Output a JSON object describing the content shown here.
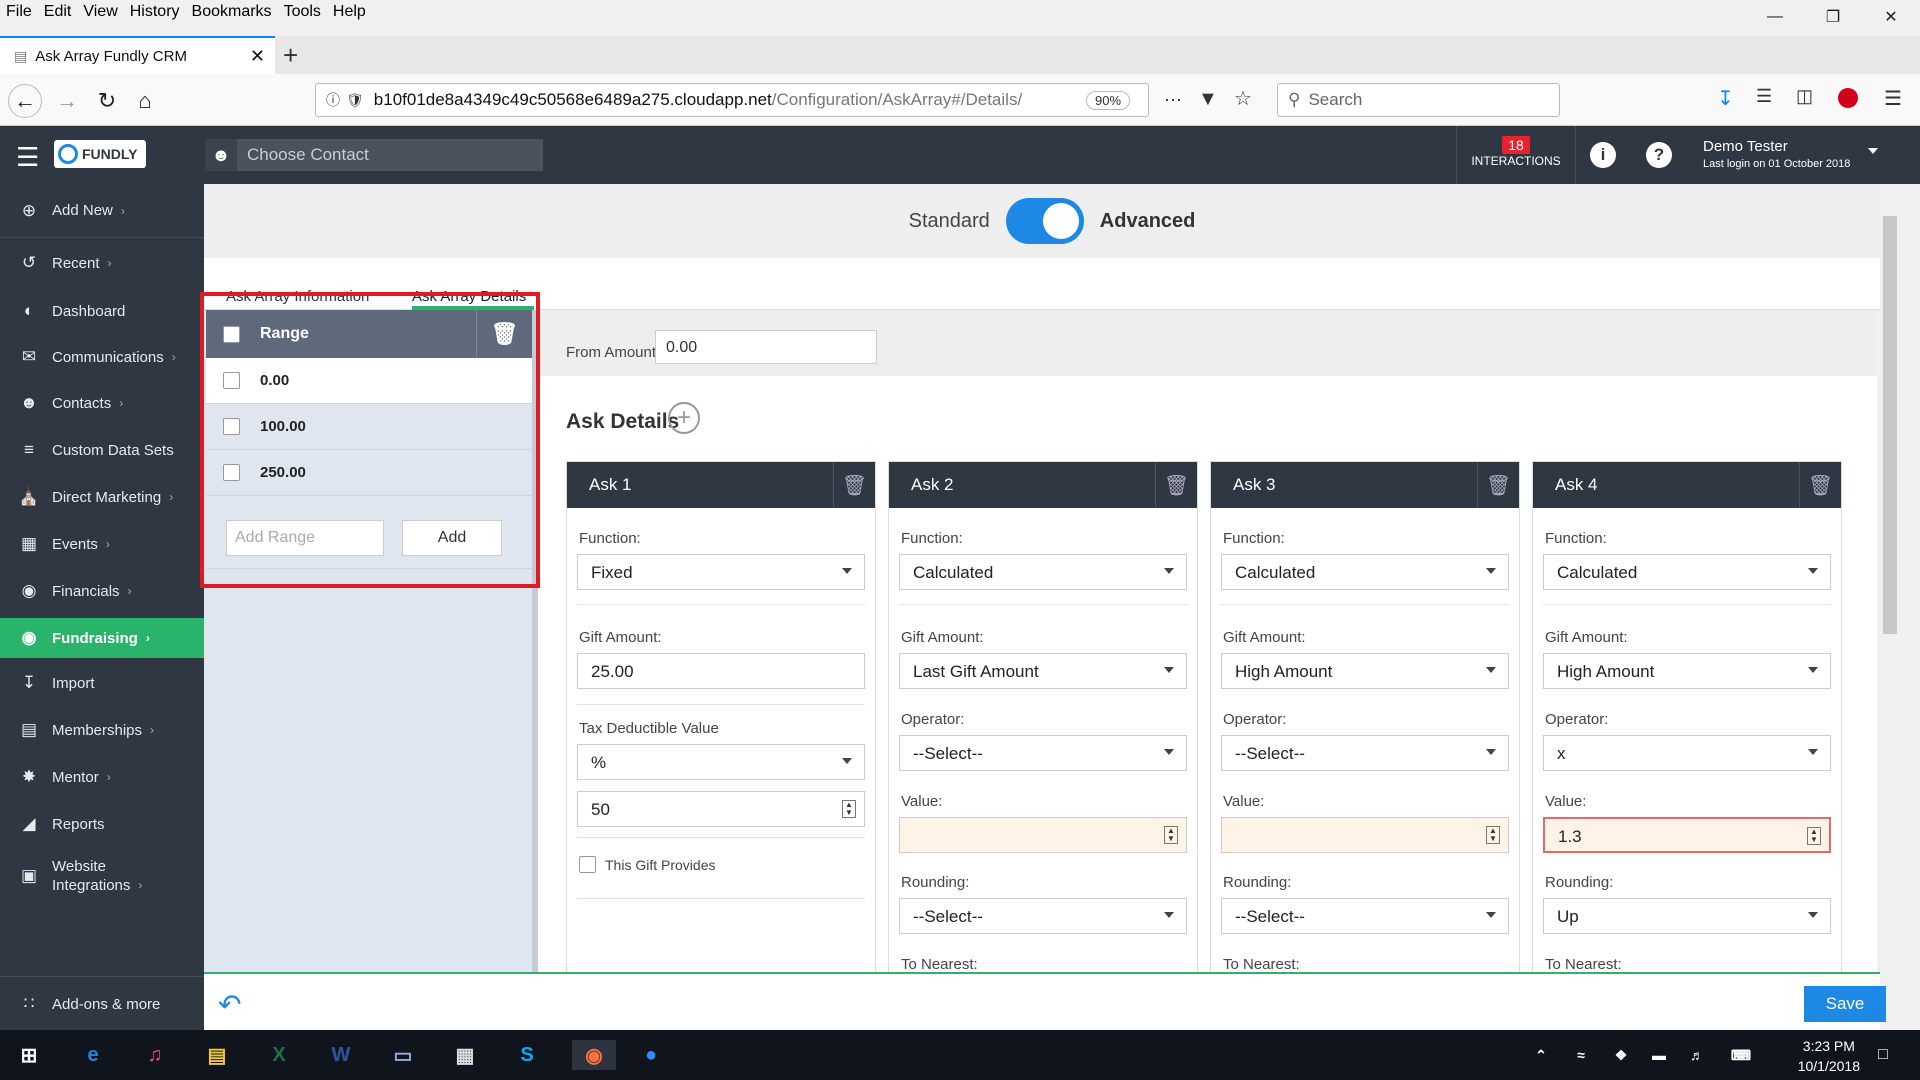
{
  "browser": {
    "menu": [
      "File",
      "Edit",
      "View",
      "History",
      "Bookmarks",
      "Tools",
      "Help"
    ],
    "tab_title": "Ask Array Fundly CRM",
    "url_host": "b10f01de8a4349c49c50568e6489a275.cloudapp.net",
    "url_path": "/Configuration/AskArray#/Details/",
    "zoom": "90%",
    "search_placeholder": "Search"
  },
  "header": {
    "logo_text": "FUNDLY",
    "contact_placeholder": "Choose Contact",
    "interactions_count": "18",
    "interactions_label": "INTERACTIONS",
    "user_name": "Demo Tester",
    "last_login": "Last login on 01 October 2018"
  },
  "sidebar": {
    "items": [
      {
        "label": "Add New",
        "icon": "plus-circle-icon"
      },
      {
        "label": "Recent",
        "icon": "history-icon"
      },
      {
        "label": "Dashboard",
        "icon": "dashboard-icon"
      },
      {
        "label": "Communications",
        "icon": "envelope-icon"
      },
      {
        "label": "Contacts",
        "icon": "person-icon"
      },
      {
        "label": "Custom Data Sets",
        "icon": "stack-icon"
      },
      {
        "label": "Direct Marketing",
        "icon": "bank-icon"
      },
      {
        "label": "Events",
        "icon": "calendar-icon"
      },
      {
        "label": "Financials",
        "icon": "money-icon"
      },
      {
        "label": "Fundraising",
        "icon": "moneybag-icon"
      },
      {
        "label": "Import",
        "icon": "download-icon"
      },
      {
        "label": "Memberships",
        "icon": "id-card-icon"
      },
      {
        "label": "Mentor",
        "icon": "runner-icon"
      },
      {
        "label": "Reports",
        "icon": "chart-icon"
      },
      {
        "label": "Website",
        "label2": "Integrations",
        "icon": "window-icon"
      }
    ],
    "addons": "Add-ons & more"
  },
  "toggle": {
    "left": "Standard",
    "right": "Advanced"
  },
  "tabs": [
    "Ask Array Information",
    "Ask Array Details"
  ],
  "range": {
    "header": "Range",
    "rows": [
      "0.00",
      "100.00",
      "250.00"
    ],
    "input_placeholder": "Add Range",
    "add_label": "Add"
  },
  "details": {
    "from_label": "From Amount",
    "from_value": "0.00",
    "title": "Ask Details"
  },
  "asks": [
    {
      "title": "Ask 1",
      "function_label": "Function:",
      "function": "Fixed",
      "gift_label": "Gift Amount:",
      "gift": "25.00",
      "tax_label": "Tax Deductible Value",
      "tax_type": "%",
      "tax_value": "50",
      "provides": "This Gift Provides"
    },
    {
      "title": "Ask 2",
      "function_label": "Function:",
      "function": "Calculated",
      "gift_label": "Gift Amount:",
      "gift": "Last Gift Amount",
      "operator_label": "Operator:",
      "operator": "--Select--",
      "value_label": "Value:",
      "value": "",
      "rounding_label": "Rounding:",
      "rounding": "--Select--",
      "nearest_label": "To Nearest:"
    },
    {
      "title": "Ask 3",
      "function_label": "Function:",
      "function": "Calculated",
      "gift_label": "Gift Amount:",
      "gift": "High Amount",
      "operator_label": "Operator:",
      "operator": "--Select--",
      "value_label": "Value:",
      "value": "",
      "rounding_label": "Rounding:",
      "rounding": "--Select--",
      "nearest_label": "To Nearest:"
    },
    {
      "title": "Ask 4",
      "function_label": "Function:",
      "function": "Calculated",
      "gift_label": "Gift Amount:",
      "gift": "High Amount",
      "operator_label": "Operator:",
      "operator": "x",
      "value_label": "Value:",
      "value": "1.3",
      "rounding_label": "Rounding:",
      "rounding": "Up",
      "nearest_label": "To Nearest:"
    }
  ],
  "footer": {
    "save": "Save"
  },
  "taskbar": {
    "time": "3:23 PM",
    "date": "10/1/2018"
  },
  "colors": {
    "accent_blue": "#1e88e5",
    "green": "#29b36b",
    "dark": "#2f3742",
    "highlight_red": "#e01a22"
  }
}
